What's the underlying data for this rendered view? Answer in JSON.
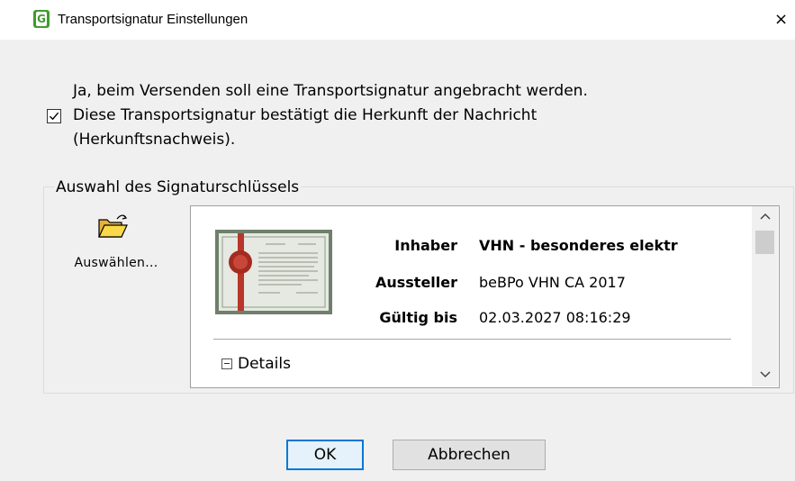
{
  "window": {
    "title": "Transportsignatur Einstellungen",
    "app_icon_letter": "G",
    "close_glyph": "×",
    "accent": "#0078d7",
    "app_color": "#3f9b2d"
  },
  "message": {
    "line1": "Ja, beim Versenden soll eine Transportsignatur angebracht werden.",
    "line2": "Diese Transportsignatur bestätigt die Herkunft der Nachricht",
    "line3": "(Herkunftsnachweis).",
    "checkbox_checked": true
  },
  "signature_group": {
    "label": "Auswahl des Signaturschlüssels",
    "select_button_label": "Auswählen...",
    "select_icon": "open-folder-icon"
  },
  "certificate": {
    "owner_label": "Inhaber",
    "owner_value": "VHN - besonderes elektr",
    "issuer_label": "Aussteller",
    "issuer_value": "beBPo VHN CA 2017",
    "valid_label": "Gültig bis",
    "valid_value": "02.03.2027 08:16:29",
    "details_label": "Details",
    "image_icon": "certificate-seal-icon"
  },
  "buttons": {
    "ok": "OK",
    "cancel": "Abbrechen"
  }
}
